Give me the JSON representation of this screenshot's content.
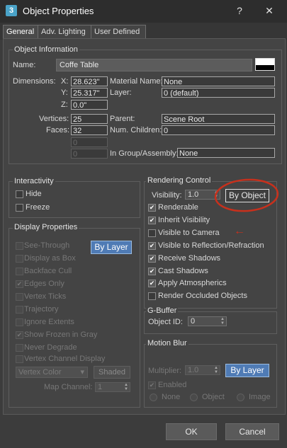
{
  "window": {
    "title": "Object Properties",
    "app_icon": "3",
    "help_glyph": "?",
    "close_glyph": "✕"
  },
  "tabs": [
    {
      "label": "General",
      "active": true
    },
    {
      "label": "Adv. Lighting",
      "active": false
    },
    {
      "label": "User Defined",
      "active": false
    }
  ],
  "object_info": {
    "group_label": "Object Information",
    "name_label": "Name:",
    "name_value": "Coffe Table",
    "dimensions_label": "Dimensions:",
    "x_label": "X:",
    "x_value": "28.623\"",
    "y_label": "Y:",
    "y_value": "25.317\"",
    "z_label": "Z:",
    "z_value": "0.0\"",
    "vertices_label": "Vertices:",
    "vertices_value": "25",
    "faces_label": "Faces:",
    "faces_value": "32",
    "extra1_value": "0",
    "extra2_value": "0",
    "material_label": "Material Name:",
    "material_value": "None",
    "layer_label": "Layer:",
    "layer_value": "0 (default)",
    "parent_label": "Parent:",
    "parent_value": "Scene Root",
    "children_label": "Num. Children:",
    "children_value": "0",
    "group_assembly_label": "In Group/Assembly:",
    "group_assembly_value": "None"
  },
  "interactivity": {
    "group_label": "Interactivity",
    "hide_label": "Hide",
    "freeze_label": "Freeze"
  },
  "display_properties": {
    "group_label": "Display Properties",
    "by_layer_label": "By Layer",
    "items": [
      {
        "label": "See-Through",
        "checked": false
      },
      {
        "label": "Display as Box",
        "checked": false
      },
      {
        "label": "Backface Cull",
        "checked": false
      },
      {
        "label": "Edges Only",
        "checked": true
      },
      {
        "label": "Vertex Ticks",
        "checked": false
      },
      {
        "label": "Trajectory",
        "checked": false
      },
      {
        "label": "Ignore Extents",
        "checked": false
      },
      {
        "label": "Show Frozen in Gray",
        "checked": true
      },
      {
        "label": "Never Degrade",
        "checked": false
      },
      {
        "label": "Vertex Channel Display",
        "checked": false
      }
    ],
    "vertex_color_label": "Vertex Color",
    "shaded_label": "Shaded",
    "map_channel_label": "Map Channel:",
    "map_channel_value": "1"
  },
  "rendering_control": {
    "group_label": "Rendering Control",
    "visibility_label": "Visibility:",
    "visibility_value": "1.0",
    "by_object_label": "By Object",
    "items": [
      {
        "label": "Renderable",
        "checked": true
      },
      {
        "label": "Inherit Visibility",
        "checked": true
      },
      {
        "label": "Visible to Camera",
        "checked": false
      },
      {
        "label": "Visible to Reflection/Refraction",
        "checked": true
      },
      {
        "label": "Receive Shadows",
        "checked": true
      },
      {
        "label": "Cast Shadows",
        "checked": true
      },
      {
        "label": "Apply Atmospherics",
        "checked": true
      },
      {
        "label": "Render Occluded Objects",
        "checked": false
      }
    ]
  },
  "gbuffer": {
    "group_label": "G-Buffer",
    "object_id_label": "Object ID:",
    "object_id_value": "0"
  },
  "motion_blur": {
    "group_label": "Motion Blur",
    "multiplier_label": "Multiplier:",
    "multiplier_value": "1.0",
    "by_layer_label": "By Layer",
    "enabled_label": "Enabled",
    "radio_options": [
      "None",
      "Object",
      "Image"
    ]
  },
  "footer": {
    "ok_label": "OK",
    "cancel_label": "Cancel"
  },
  "annotation": {
    "circle_color": "#c8301c",
    "arrow_glyph": "←"
  }
}
